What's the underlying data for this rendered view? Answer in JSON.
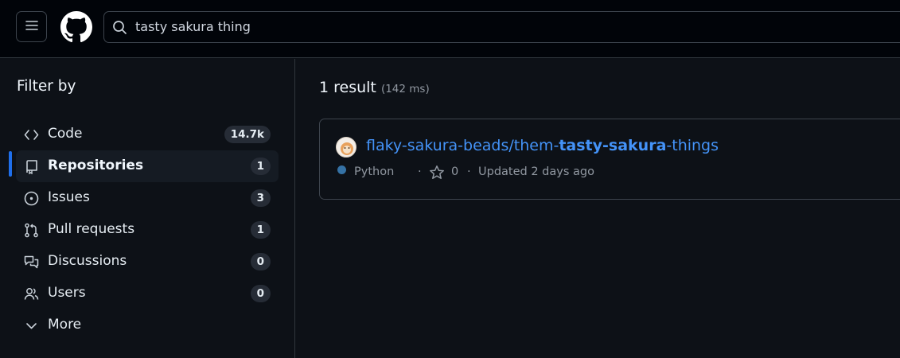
{
  "header": {
    "menu_icon": "hamburger-icon",
    "logo_icon": "github-logo-icon",
    "search": {
      "value": "tasty sakura thing",
      "icon": "search-icon"
    }
  },
  "sidebar": {
    "title": "Filter by",
    "items": [
      {
        "label": "Code",
        "count": "14.7k",
        "icon": "code-icon",
        "selected": false
      },
      {
        "label": "Repositories",
        "count": "1",
        "icon": "repo-icon",
        "selected": true
      },
      {
        "label": "Issues",
        "count": "3",
        "icon": "issue-icon",
        "selected": false
      },
      {
        "label": "Pull requests",
        "count": "1",
        "icon": "pull-request-icon",
        "selected": false
      },
      {
        "label": "Discussions",
        "count": "0",
        "icon": "discussion-icon",
        "selected": false
      },
      {
        "label": "Users",
        "count": "0",
        "icon": "users-icon",
        "selected": false
      },
      {
        "label": "More",
        "icon": "chevron-down-icon"
      }
    ]
  },
  "results": {
    "count_label": "1 result",
    "time_label": "(142 ms)",
    "items": [
      {
        "owner_prefix": "flaky-sakura-beads/them-",
        "highlight1": "tasty",
        "sep": "-",
        "highlight2": "sakura",
        "suffix": "-things",
        "language": "Python",
        "language_color": "#3572a5",
        "stars": "0",
        "updated": "Updated 2 days ago",
        "dot": "·"
      }
    ]
  },
  "colors": {
    "accent": "#1f6feb",
    "link": "#4493f8",
    "background": "#0d1117"
  }
}
